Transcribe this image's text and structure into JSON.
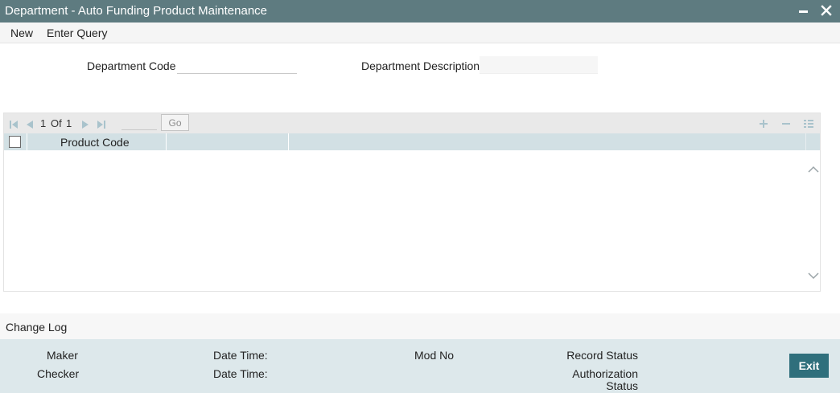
{
  "window": {
    "title": "Department - Auto Funding Product Maintenance"
  },
  "menu": {
    "new_label": "New",
    "enter_query_label": "Enter Query"
  },
  "form": {
    "department_code": {
      "label": "Department Code",
      "value": ""
    },
    "department_description": {
      "label": "Department Description",
      "value": ""
    }
  },
  "grid": {
    "pager": {
      "current": "1",
      "of_label": "Of",
      "total": "1",
      "page_input": ""
    },
    "go_label": "Go",
    "columns": [
      "Product Code",
      ""
    ],
    "rows": []
  },
  "change_log": {
    "label": "Change Log"
  },
  "audit": {
    "maker_label": "Maker",
    "checker_label": "Checker",
    "maker_datetime_label": "Date Time:",
    "checker_datetime_label": "Date Time:",
    "mod_no_label": "Mod No",
    "record_status_label": "Record Status",
    "authorization_status_label_line1": "Authorization",
    "authorization_status_label_line2": "Status"
  },
  "buttons": {
    "exit_label": "Exit"
  },
  "colors": {
    "titlebar": "#5e7b80",
    "grid_header": "#d2e0e4",
    "audit_bar": "#dde8eb",
    "exit_button": "#2f6f7c"
  }
}
